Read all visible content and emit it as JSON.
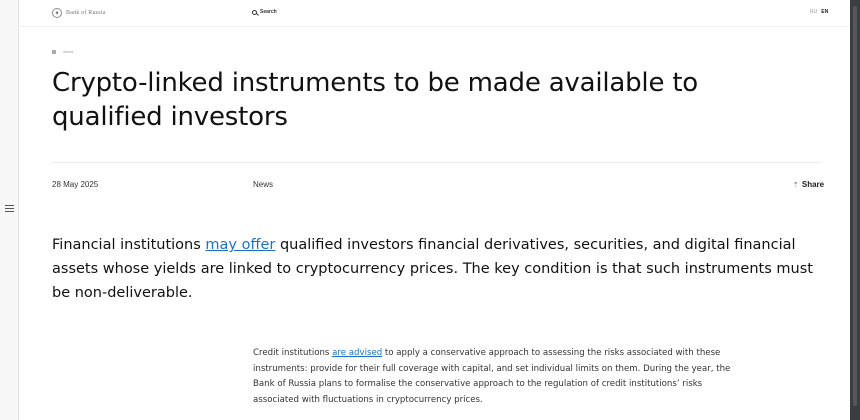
{
  "header": {
    "logo_text": "Bank of Russia",
    "search_label": "Search",
    "lang_ru": "RU",
    "lang_en": "EN"
  },
  "breadcrumb": {
    "current": "News"
  },
  "article": {
    "title": "Crypto-linked instruments to be made available to qualified investors",
    "date": "28 May 2025",
    "category": "News",
    "share_label": "Share",
    "lead": {
      "before": "Financial institutions ",
      "link": "may offer",
      "after": " qualified investors financial derivatives, securities, and digital financial assets whose yields are linked to cryptocurrency prices. The key condition is that such instruments must be non-deliverable."
    },
    "body": {
      "before": "Credit institutions ",
      "link": "are advised",
      "after": " to apply a conservative approach to assessing the risks associated with these instruments: provide for their full coverage with capital, and set individual limits on them. During the year, the Bank of Russia plans to formalise the conservative approach to the regulation of credit institutions’ risks associated with fluctuations in cryptocurrency prices."
    }
  },
  "colors": {
    "link": "#1a73c9",
    "text": "#111111",
    "background": "#ffffff"
  },
  "icons": [
    "menu-icon",
    "bank-emblem-icon",
    "search-icon",
    "home-icon",
    "share-icon"
  ]
}
